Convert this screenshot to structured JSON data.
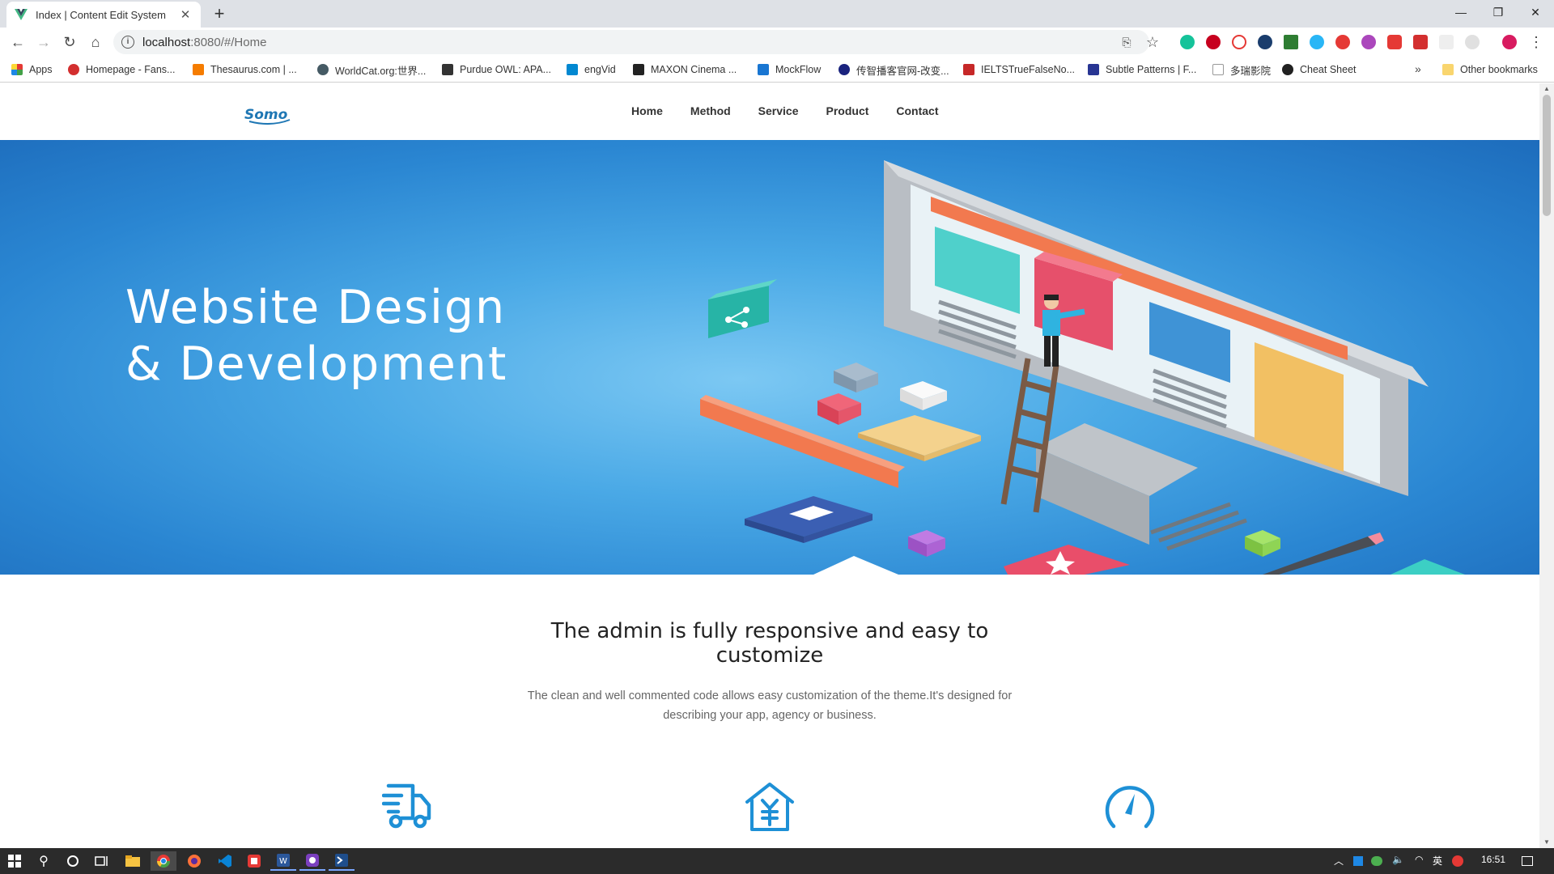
{
  "browser": {
    "tab_title": "Index | Content Edit System",
    "tab_close": "✕",
    "new_tab": "+",
    "url_host": "localhost",
    "url_rest": ":8080/#/Home",
    "window_minimize": "—",
    "window_restore": "❐",
    "window_close": "✕"
  },
  "bookmarks": [
    {
      "label": "Apps",
      "color": "#e53935"
    },
    {
      "label": "Homepage - Fans...",
      "color": "#d32f2f"
    },
    {
      "label": "Thesaurus.com | ...",
      "color": "#f57c00"
    },
    {
      "label": "WorldCat.org:世界...",
      "color": "#455a64"
    },
    {
      "label": "Purdue OWL: APA...",
      "color": "#333333"
    },
    {
      "label": "engVid",
      "color": "#0288d1"
    },
    {
      "label": "MAXON Cinema ...",
      "color": "#222222"
    },
    {
      "label": "MockFlow",
      "color": "#1976d2"
    },
    {
      "label": "传智播客官网-改变...",
      "color": "#1a237e"
    },
    {
      "label": "IELTSTrueFalseNo...",
      "color": "#c62828"
    },
    {
      "label": "Subtle Patterns | F...",
      "color": "#283593"
    },
    {
      "label": "多瑞影院",
      "color": "#9e9e9e"
    },
    {
      "label": "Cheat Sheet",
      "color": "#212121"
    }
  ],
  "bookmarks_more": "»",
  "other_bookmarks": "Other bookmarks",
  "site": {
    "logo_text": "Somo",
    "nav": [
      "Home",
      "Method",
      "Service",
      "Product",
      "Contact"
    ]
  },
  "hero": {
    "title_line1": "Website Design",
    "title_line2": "& Development"
  },
  "intro": {
    "title": "The admin is fully responsive and easy to customize",
    "text": "The clean and well commented code allows easy customization of the theme.It's designed for describing your app, agency or business."
  },
  "features": [
    {
      "icon": "delivery-truck-icon"
    },
    {
      "icon": "yuan-house-icon"
    },
    {
      "icon": "speedometer-icon"
    }
  ],
  "taskbar": {
    "clock": "16:51",
    "ime": "英"
  },
  "colors": {
    "accent_blue": "#1e90d6",
    "hero_dark": "#1d6cbc",
    "hero_light": "#7cc8f3"
  }
}
